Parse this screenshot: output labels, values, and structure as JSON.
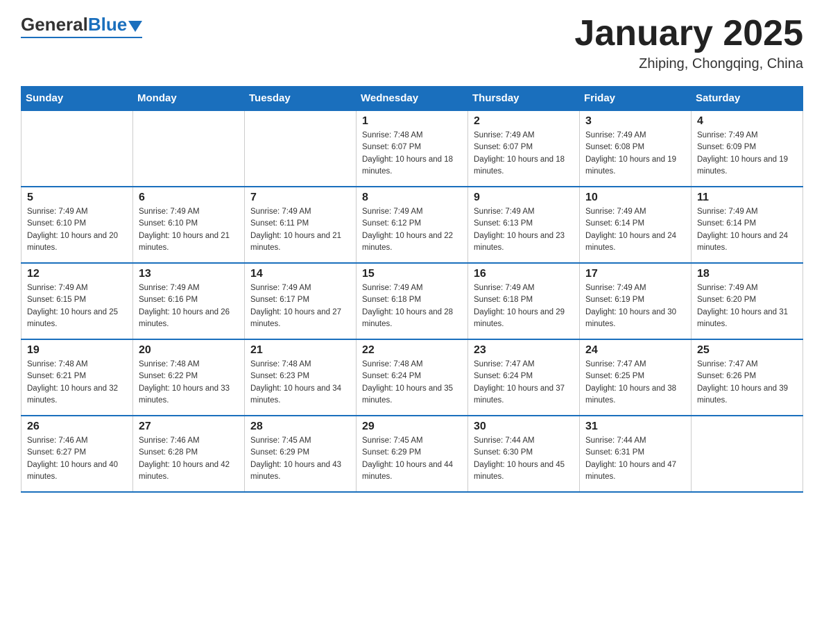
{
  "header": {
    "logo_general": "General",
    "logo_blue": "Blue",
    "month_title": "January 2025",
    "location": "Zhiping, Chongqing, China"
  },
  "days_of_week": [
    "Sunday",
    "Monday",
    "Tuesday",
    "Wednesday",
    "Thursday",
    "Friday",
    "Saturday"
  ],
  "weeks": [
    [
      {
        "day": "",
        "sunrise": "",
        "sunset": "",
        "daylight": ""
      },
      {
        "day": "",
        "sunrise": "",
        "sunset": "",
        "daylight": ""
      },
      {
        "day": "",
        "sunrise": "",
        "sunset": "",
        "daylight": ""
      },
      {
        "day": "1",
        "sunrise": "Sunrise: 7:48 AM",
        "sunset": "Sunset: 6:07 PM",
        "daylight": "Daylight: 10 hours and 18 minutes."
      },
      {
        "day": "2",
        "sunrise": "Sunrise: 7:49 AM",
        "sunset": "Sunset: 6:07 PM",
        "daylight": "Daylight: 10 hours and 18 minutes."
      },
      {
        "day": "3",
        "sunrise": "Sunrise: 7:49 AM",
        "sunset": "Sunset: 6:08 PM",
        "daylight": "Daylight: 10 hours and 19 minutes."
      },
      {
        "day": "4",
        "sunrise": "Sunrise: 7:49 AM",
        "sunset": "Sunset: 6:09 PM",
        "daylight": "Daylight: 10 hours and 19 minutes."
      }
    ],
    [
      {
        "day": "5",
        "sunrise": "Sunrise: 7:49 AM",
        "sunset": "Sunset: 6:10 PM",
        "daylight": "Daylight: 10 hours and 20 minutes."
      },
      {
        "day": "6",
        "sunrise": "Sunrise: 7:49 AM",
        "sunset": "Sunset: 6:10 PM",
        "daylight": "Daylight: 10 hours and 21 minutes."
      },
      {
        "day": "7",
        "sunrise": "Sunrise: 7:49 AM",
        "sunset": "Sunset: 6:11 PM",
        "daylight": "Daylight: 10 hours and 21 minutes."
      },
      {
        "day": "8",
        "sunrise": "Sunrise: 7:49 AM",
        "sunset": "Sunset: 6:12 PM",
        "daylight": "Daylight: 10 hours and 22 minutes."
      },
      {
        "day": "9",
        "sunrise": "Sunrise: 7:49 AM",
        "sunset": "Sunset: 6:13 PM",
        "daylight": "Daylight: 10 hours and 23 minutes."
      },
      {
        "day": "10",
        "sunrise": "Sunrise: 7:49 AM",
        "sunset": "Sunset: 6:14 PM",
        "daylight": "Daylight: 10 hours and 24 minutes."
      },
      {
        "day": "11",
        "sunrise": "Sunrise: 7:49 AM",
        "sunset": "Sunset: 6:14 PM",
        "daylight": "Daylight: 10 hours and 24 minutes."
      }
    ],
    [
      {
        "day": "12",
        "sunrise": "Sunrise: 7:49 AM",
        "sunset": "Sunset: 6:15 PM",
        "daylight": "Daylight: 10 hours and 25 minutes."
      },
      {
        "day": "13",
        "sunrise": "Sunrise: 7:49 AM",
        "sunset": "Sunset: 6:16 PM",
        "daylight": "Daylight: 10 hours and 26 minutes."
      },
      {
        "day": "14",
        "sunrise": "Sunrise: 7:49 AM",
        "sunset": "Sunset: 6:17 PM",
        "daylight": "Daylight: 10 hours and 27 minutes."
      },
      {
        "day": "15",
        "sunrise": "Sunrise: 7:49 AM",
        "sunset": "Sunset: 6:18 PM",
        "daylight": "Daylight: 10 hours and 28 minutes."
      },
      {
        "day": "16",
        "sunrise": "Sunrise: 7:49 AM",
        "sunset": "Sunset: 6:18 PM",
        "daylight": "Daylight: 10 hours and 29 minutes."
      },
      {
        "day": "17",
        "sunrise": "Sunrise: 7:49 AM",
        "sunset": "Sunset: 6:19 PM",
        "daylight": "Daylight: 10 hours and 30 minutes."
      },
      {
        "day": "18",
        "sunrise": "Sunrise: 7:49 AM",
        "sunset": "Sunset: 6:20 PM",
        "daylight": "Daylight: 10 hours and 31 minutes."
      }
    ],
    [
      {
        "day": "19",
        "sunrise": "Sunrise: 7:48 AM",
        "sunset": "Sunset: 6:21 PM",
        "daylight": "Daylight: 10 hours and 32 minutes."
      },
      {
        "day": "20",
        "sunrise": "Sunrise: 7:48 AM",
        "sunset": "Sunset: 6:22 PM",
        "daylight": "Daylight: 10 hours and 33 minutes."
      },
      {
        "day": "21",
        "sunrise": "Sunrise: 7:48 AM",
        "sunset": "Sunset: 6:23 PM",
        "daylight": "Daylight: 10 hours and 34 minutes."
      },
      {
        "day": "22",
        "sunrise": "Sunrise: 7:48 AM",
        "sunset": "Sunset: 6:24 PM",
        "daylight": "Daylight: 10 hours and 35 minutes."
      },
      {
        "day": "23",
        "sunrise": "Sunrise: 7:47 AM",
        "sunset": "Sunset: 6:24 PM",
        "daylight": "Daylight: 10 hours and 37 minutes."
      },
      {
        "day": "24",
        "sunrise": "Sunrise: 7:47 AM",
        "sunset": "Sunset: 6:25 PM",
        "daylight": "Daylight: 10 hours and 38 minutes."
      },
      {
        "day": "25",
        "sunrise": "Sunrise: 7:47 AM",
        "sunset": "Sunset: 6:26 PM",
        "daylight": "Daylight: 10 hours and 39 minutes."
      }
    ],
    [
      {
        "day": "26",
        "sunrise": "Sunrise: 7:46 AM",
        "sunset": "Sunset: 6:27 PM",
        "daylight": "Daylight: 10 hours and 40 minutes."
      },
      {
        "day": "27",
        "sunrise": "Sunrise: 7:46 AM",
        "sunset": "Sunset: 6:28 PM",
        "daylight": "Daylight: 10 hours and 42 minutes."
      },
      {
        "day": "28",
        "sunrise": "Sunrise: 7:45 AM",
        "sunset": "Sunset: 6:29 PM",
        "daylight": "Daylight: 10 hours and 43 minutes."
      },
      {
        "day": "29",
        "sunrise": "Sunrise: 7:45 AM",
        "sunset": "Sunset: 6:29 PM",
        "daylight": "Daylight: 10 hours and 44 minutes."
      },
      {
        "day": "30",
        "sunrise": "Sunrise: 7:44 AM",
        "sunset": "Sunset: 6:30 PM",
        "daylight": "Daylight: 10 hours and 45 minutes."
      },
      {
        "day": "31",
        "sunrise": "Sunrise: 7:44 AM",
        "sunset": "Sunset: 6:31 PM",
        "daylight": "Daylight: 10 hours and 47 minutes."
      },
      {
        "day": "",
        "sunrise": "",
        "sunset": "",
        "daylight": ""
      }
    ]
  ]
}
